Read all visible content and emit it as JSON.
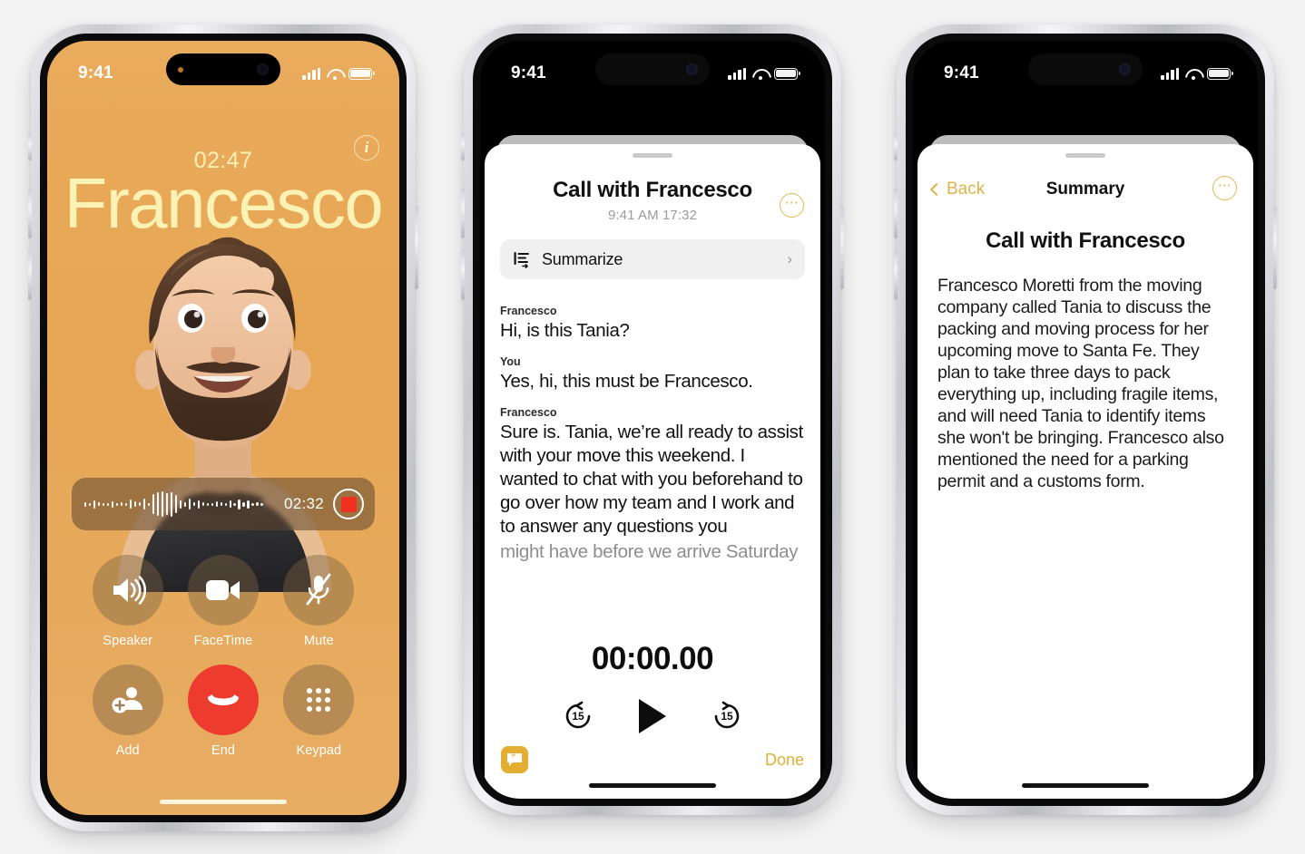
{
  "background_color": "#f4f4f4",
  "accent_colors": {
    "call_background": "#e7a855",
    "call_name_text": "#fcf2b4",
    "end_call_red": "#ee3b2f",
    "record_red": "#f03020",
    "yellow_accent": "#e0b94e",
    "done_yellow": "#e0b038",
    "quote_button": "#e3ae32"
  },
  "phone1": {
    "name": "call-screen",
    "status_bar": {
      "time": "9:41",
      "signal": "cellular-bars-icon",
      "wifi": "wifi-icon",
      "battery": "battery-icon"
    },
    "info_button": "i",
    "call_timer": "02:47",
    "callee_name": "Francesco",
    "avatar": "memoji-avatar",
    "recording_bar": {
      "waveform": "audio-waveform",
      "elapsed": "02:32",
      "record_button": "stop-record-button"
    },
    "controls": [
      {
        "label": "Speaker",
        "icon": "speaker-icon",
        "style": "normal"
      },
      {
        "label": "FaceTime",
        "icon": "video-icon",
        "style": "normal"
      },
      {
        "label": "Mute",
        "icon": "mic-off-icon",
        "style": "normal"
      },
      {
        "label": "Add",
        "icon": "add-person-icon",
        "style": "normal"
      },
      {
        "label": "End",
        "icon": "end-call-icon",
        "style": "end"
      },
      {
        "label": "Keypad",
        "icon": "keypad-icon",
        "style": "normal"
      }
    ]
  },
  "phone2": {
    "name": "call-transcript-sheet",
    "status_bar": {
      "time": "9:41",
      "signal": "cellular-bars-icon",
      "wifi": "wifi-icon",
      "battery": "battery-icon"
    },
    "sheet_title": "Call with Francesco",
    "sheet_subtitle": "9:41 AM  17:32",
    "more_button": "⋯",
    "summarize_row": {
      "icon": "summarize-icon",
      "label": "Summarize",
      "chevron": "›"
    },
    "transcript": [
      {
        "speaker": "Francesco",
        "text": "Hi, is this Tania?",
        "faded": false
      },
      {
        "speaker": "You",
        "text": "Yes, hi, this must be Francesco.",
        "faded": false
      },
      {
        "speaker": "Francesco",
        "text": "Sure is. Tania, we’re all ready to assist with your move this weekend. I wanted to chat with you beforehand to go over how my team and I work and to answer any questions you",
        "faded": false
      },
      {
        "speaker": "",
        "text": "might have before we arrive Saturday",
        "faded": true
      }
    ],
    "player": {
      "time": "00:00.00",
      "skip_back": "15",
      "skip_back_icon": "rewind-15-icon",
      "play": "play-icon",
      "skip_forward": "15",
      "skip_forward_icon": "forward-15-icon"
    },
    "footer": {
      "quote_button": "transcript-quote-icon",
      "quote_glyph": "”",
      "done_label": "Done"
    }
  },
  "phone3": {
    "name": "summary-screen",
    "status_bar": {
      "time": "9:41",
      "signal": "cellular-bars-icon",
      "wifi": "wifi-icon",
      "battery": "battery-icon"
    },
    "nav": {
      "back_label": "Back",
      "title": "Summary",
      "more_button": "⋯"
    },
    "heading": "Call with Francesco",
    "body": "Francesco Moretti from the moving company called Tania to discuss the packing and moving process for her upcoming move to Santa Fe. They plan to take three days to pack everything up, including fragile items, and will need Tania to identify items she won't be bringing. Francesco also mentioned the need for a parking permit and a customs form."
  }
}
